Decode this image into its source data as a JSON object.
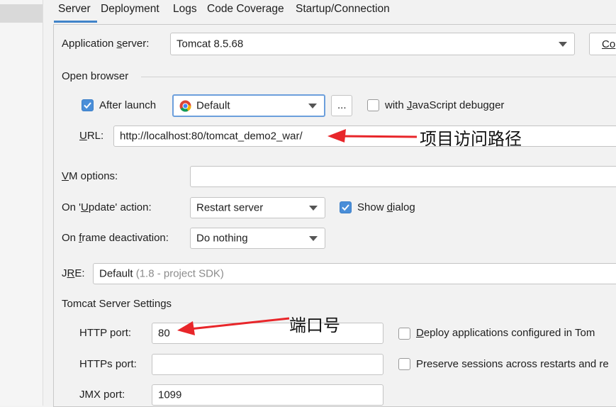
{
  "tabs": [
    "Server",
    "Deployment",
    "Logs",
    "Code Coverage",
    "Startup/Connection"
  ],
  "application_server": {
    "label_pre": "Application ",
    "label_ul": "s",
    "label_post": "erver:",
    "value": "Tomcat 8.5.68",
    "configure_button": "Co"
  },
  "open_browser": {
    "title": "Open browser",
    "after_launch": {
      "label": "After launch",
      "checked": true
    },
    "browser": {
      "value": "Default",
      "icon": "chrome-icon"
    },
    "more_button": "...",
    "js_debugger": {
      "pre": "with ",
      "ul": "J",
      "post": "avaScript debugger",
      "checked": false
    },
    "url": {
      "label_ul": "U",
      "label_post": "RL:",
      "value": "http://localhost:80/tomcat_demo2_war/"
    }
  },
  "vm_options": {
    "label_ul": "V",
    "label_post": "M options:",
    "value": ""
  },
  "update_action": {
    "label_pre": "On '",
    "label_ul": "U",
    "label_post": "pdate' action:",
    "value": "Restart server",
    "show_dialog": {
      "pre": "Show ",
      "ul": "d",
      "post": "ialog",
      "checked": true
    }
  },
  "frame_deactivation": {
    "label_pre": "On ",
    "label_ul": "f",
    "label_post": "rame deactivation:",
    "value": "Do nothing"
  },
  "jre": {
    "label_pre": "J",
    "label_ul": "R",
    "label_post": "E:",
    "value": "Default",
    "hint": "(1.8 - project SDK)"
  },
  "tomcat_settings": {
    "title": "Tomcat Server Settings",
    "http_port": {
      "label": "HTTP port:",
      "value": "80"
    },
    "https_port": {
      "label": "HTTPs port:",
      "value": ""
    },
    "jmx_port": {
      "label": "JMX port:",
      "value": "1099"
    },
    "deploy_apps": {
      "ul": "D",
      "post": "eploy applications configured in Tom",
      "checked": false
    },
    "preserve_sessions": {
      "label": "Preserve sessions across restarts and re",
      "checked": false
    }
  },
  "annotations": {
    "url_note": "项目访问路径",
    "port_note": "端口号",
    "arrow_color": "#e8262a"
  },
  "colors": {
    "accent": "#4083c9",
    "checkbox": "#4a8ed8"
  }
}
